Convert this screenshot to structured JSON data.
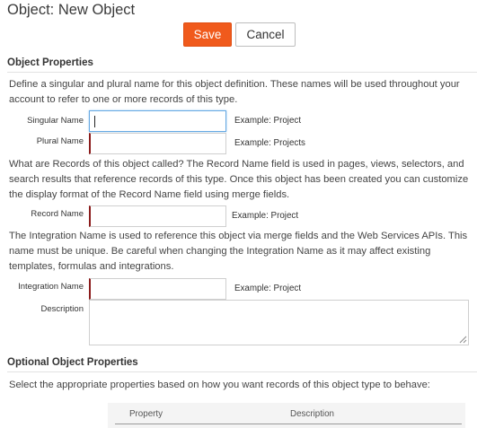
{
  "header": {
    "title": "Object: New Object",
    "save_label": "Save",
    "cancel_label": "Cancel"
  },
  "colors": {
    "accent": "#f05a1c",
    "required_marker": "#8b1c1c",
    "focus_border": "#66a9e3"
  },
  "object_properties": {
    "section_title": "Object Properties",
    "intro": "Define a singular and plural name for this object definition. These names will be used throughout your account to refer to one or more records of this type.",
    "singular_label": "Singular Name",
    "singular_value": "",
    "singular_example": "Example: Project",
    "plural_label": "Plural Name",
    "plural_value": "",
    "plural_example": "Example: Projects",
    "record_intro": "What are Records of this object called? The Record Name field is used in pages, views, selectors, and search results that reference records of this type. Once this object has been created you can customize the display format of the Record Name field using merge fields.",
    "record_label": "Record Name",
    "record_value": "",
    "record_example": "Example: Project",
    "integration_intro": "The Integration Name is used to reference this object via merge fields and the Web Services APIs. This name must be unique. Be careful when changing the Integration Name as it may affect existing templates, formulas and integrations.",
    "integration_label": "Integration Name",
    "integration_value": "",
    "integration_example": "Example: Project",
    "description_label": "Description",
    "description_value": ""
  },
  "optional_properties": {
    "section_title": "Optional Object Properties",
    "intro": "Select the appropriate properties based on how you want records of this object type to behave:",
    "columns": [
      "Property",
      "Description"
    ]
  }
}
